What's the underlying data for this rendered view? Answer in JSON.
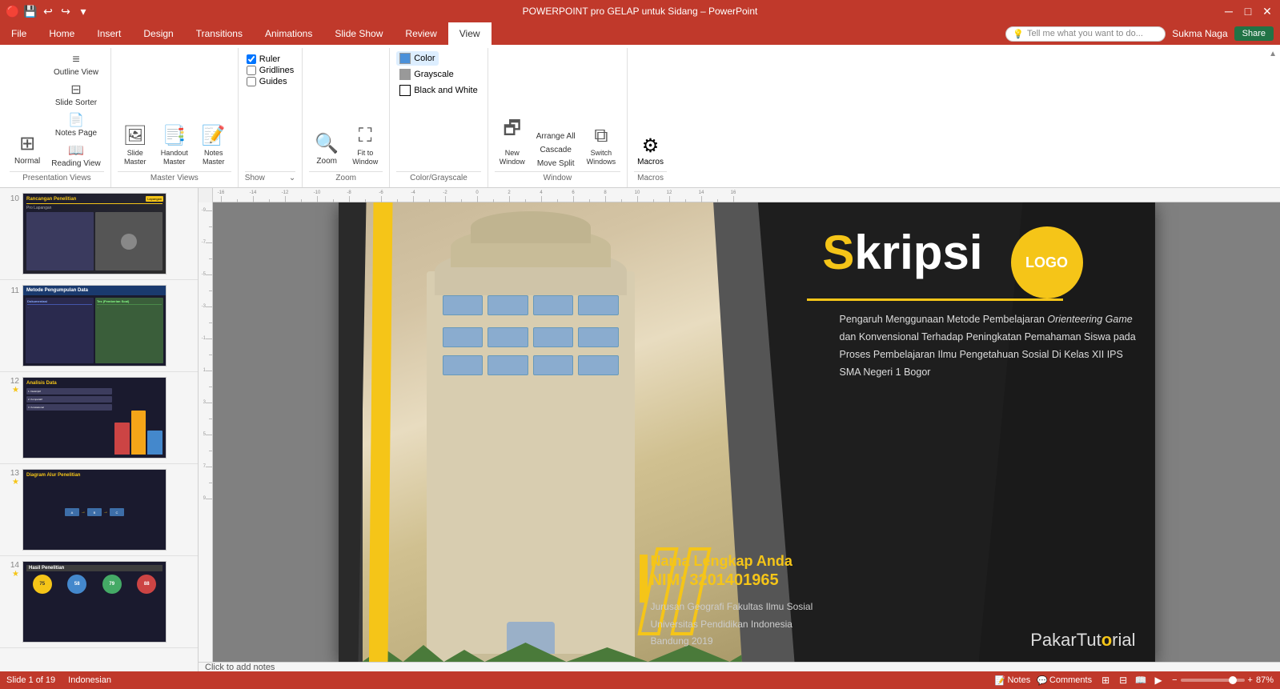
{
  "titlebar": {
    "filename": "POWERPOINT pro GELAP untuk Sidang – PowerPoint",
    "minimize": "─",
    "maximize": "□",
    "close": "✕"
  },
  "ribbon": {
    "tabs": [
      {
        "id": "file",
        "label": "File"
      },
      {
        "id": "home",
        "label": "Home"
      },
      {
        "id": "insert",
        "label": "Insert"
      },
      {
        "id": "design",
        "label": "Design"
      },
      {
        "id": "transitions",
        "label": "Transitions"
      },
      {
        "id": "animations",
        "label": "Animations"
      },
      {
        "id": "slideshow",
        "label": "Slide Show"
      },
      {
        "id": "review",
        "label": "Review"
      },
      {
        "id": "view",
        "label": "View",
        "active": true
      }
    ],
    "groups": {
      "presentation_views": {
        "label": "Presentation Views",
        "buttons": [
          {
            "id": "normal",
            "label": "Normal"
          },
          {
            "id": "outline_view",
            "label": "Outline View"
          },
          {
            "id": "slide_sorter",
            "label": "Slide Sorter"
          },
          {
            "id": "notes_page",
            "label": "Notes Page"
          },
          {
            "id": "reading_view",
            "label": "Reading View"
          }
        ]
      },
      "master_views": {
        "label": "Master Views",
        "buttons": [
          {
            "id": "slide_master",
            "label": "Slide Master"
          },
          {
            "id": "handout_master",
            "label": "Handout Master"
          },
          {
            "id": "notes_master",
            "label": "Notes Master"
          }
        ]
      },
      "show": {
        "label": "Show",
        "checkboxes": [
          {
            "id": "ruler",
            "label": "Ruler",
            "checked": true
          },
          {
            "id": "gridlines",
            "label": "Gridlines",
            "checked": false
          },
          {
            "id": "guides",
            "label": "Guides",
            "checked": false
          }
        ],
        "expand_icon": "⌄"
      },
      "zoom": {
        "label": "Zoom",
        "buttons": [
          {
            "id": "zoom",
            "label": "Zoom"
          },
          {
            "id": "fit_to_window",
            "label": "Fit to Window"
          }
        ]
      },
      "color_grayscale": {
        "label": "Color/Grayscale",
        "items": [
          {
            "id": "color",
            "label": "Color",
            "active": true
          },
          {
            "id": "grayscale",
            "label": "Grayscale"
          },
          {
            "id": "black_and_white",
            "label": "Black and White"
          }
        ]
      },
      "window": {
        "label": "Window",
        "buttons": [
          {
            "id": "new_window",
            "label": "New Window"
          },
          {
            "id": "arrange_all",
            "label": "Arrange All"
          },
          {
            "id": "cascade",
            "label": "Cascade"
          },
          {
            "id": "move_split",
            "label": "Move Split"
          },
          {
            "id": "switch_windows",
            "label": "Switch Windows"
          }
        ]
      },
      "macros": {
        "label": "Macros",
        "buttons": [
          {
            "id": "macros",
            "label": "Macros"
          }
        ]
      }
    },
    "tell_me": "Tell me what you want to do...",
    "user": "Sukma Naga",
    "share_label": "Share"
  },
  "slide_panel": {
    "slides": [
      {
        "number": "10",
        "star": false,
        "title": "Rancangan Penelitian",
        "badge": "Pro Lapangan"
      },
      {
        "number": "11",
        "star": false,
        "title": "Metode Pengumpulan Data"
      },
      {
        "number": "12",
        "star": true,
        "title": "Analisis Data"
      },
      {
        "number": "13",
        "star": true,
        "title": "Diagram Alur Penelitian"
      },
      {
        "number": "14",
        "star": true,
        "title": "Hasil Penelitian"
      }
    ]
  },
  "main_slide": {
    "title_s": "S",
    "title_rest": "kripsi",
    "logo": "LOGO",
    "subtitle": "Pengaruh Menggunaan Metode Pembelajaran Orienteering Game dan Konvensional Terhadap Peningkatan Pemahaman Siswa pada Proses Pembelajaran Ilmu Pengetahuan Sosial Di Kelas XII IPS SMA Negeri 1 Bogor",
    "name": "Nama Lengkap Anda",
    "nim": "NIM: 3201401965",
    "faculty": "Jurusan Geografi  Fakultas Ilmu Sosial",
    "university": "Universitas Pendidikan Indonesia",
    "city_year": "Bandung 2019",
    "brand": "PakarTutorial"
  },
  "status_bar": {
    "slide_info": "Slide 1 of 19",
    "language": "Indonesian",
    "notes_label": "Notes",
    "comments_label": "Comments",
    "zoom_percent": "87%",
    "zoom_value": 87
  },
  "ruler": {
    "h_ticks": [
      "-16",
      "-15",
      "-14",
      "-13",
      "-12",
      "-11",
      "-10",
      "-9",
      "-8",
      "-7",
      "-6",
      "-5",
      "-4",
      "-3",
      "-2",
      "-1",
      "0",
      "1",
      "2",
      "3",
      "4",
      "5",
      "6",
      "7",
      "8",
      "9",
      "10",
      "11",
      "12",
      "13",
      "14",
      "15",
      "16"
    ],
    "v_ticks": [
      "-9",
      "-8",
      "-7",
      "-6",
      "-5",
      "-4",
      "-3",
      "-2",
      "-1",
      "0",
      "1",
      "2",
      "3",
      "4",
      "5",
      "6",
      "7",
      "8",
      "9"
    ]
  }
}
